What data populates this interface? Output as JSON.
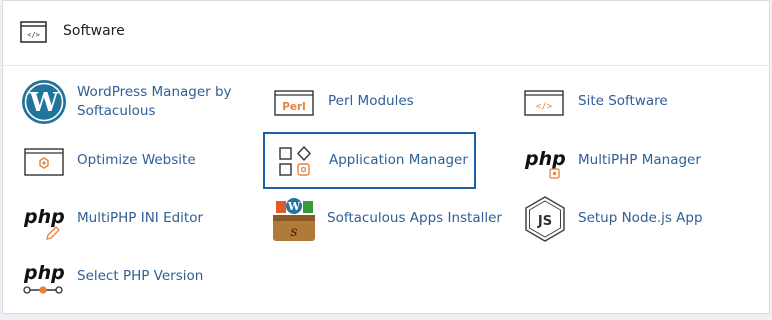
{
  "section": {
    "title": "Software",
    "icon": "code-window-icon"
  },
  "items": [
    {
      "label": "WordPress Manager by Softaculous",
      "icon": "wordpress-icon"
    },
    {
      "label": "Perl Modules",
      "icon": "perl-icon"
    },
    {
      "label": "Site Software",
      "icon": "code-window-icon"
    },
    {
      "label": "Optimize Website",
      "icon": "optimize-gear-icon"
    },
    {
      "label": "Application Manager",
      "icon": "application-manager-icon",
      "selected": true
    },
    {
      "label": "MultiPHP Manager",
      "icon": "php-icon"
    },
    {
      "label": "MultiPHP INI Editor",
      "icon": "php-ini-icon"
    },
    {
      "label": "Softaculous Apps Installer",
      "icon": "softaculous-icon"
    },
    {
      "label": "Setup Node.js App",
      "icon": "nodejs-icon"
    },
    {
      "label": "Select PHP Version",
      "icon": "php-version-icon"
    }
  ],
  "colors": {
    "link": "#2f5f96",
    "accent": "#e8813a",
    "selection_border": "#1b5fa8",
    "wordpress_blue": "#21759b"
  }
}
